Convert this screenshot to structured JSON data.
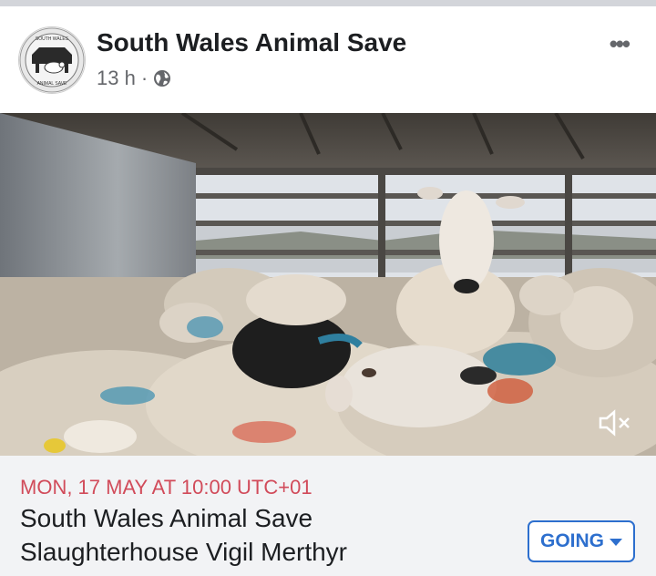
{
  "post": {
    "page_name": "South Wales Animal Save",
    "time": "13 h",
    "separator": "·",
    "audience_icon": "globe-icon",
    "more_icon": "more-options-icon",
    "more_glyph": "•••",
    "avatar_logo_text_top": "SOUTH WALES",
    "avatar_logo_text_bottom": "ANIMAL SAVE"
  },
  "video": {
    "mute_icon": "speaker-muted-icon"
  },
  "event": {
    "date": "MON, 17 MAY AT 10:00 UTC+01",
    "title_line1": "South Wales Animal Save",
    "title_line2": "Slaughterhouse Vigil Merthyr",
    "going_label": "GOING"
  },
  "colors": {
    "accent_blue": "#2d6fce",
    "date_red": "#d14b5a",
    "event_bg": "#f2f3f5",
    "text_dark": "#1c1e21",
    "text_muted": "#65676b"
  }
}
